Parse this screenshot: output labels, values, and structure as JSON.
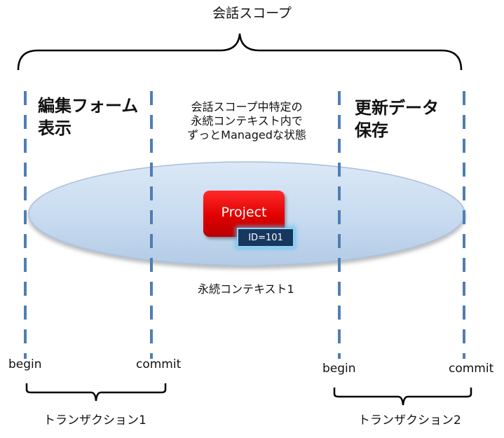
{
  "title": "会話スコープ",
  "phases": {
    "left": {
      "line1": "編集フォーム",
      "line2": "表示"
    },
    "middle": {
      "line1": "会話スコープ中特定の",
      "line2": "永続コンテキスト内で",
      "line3": "ずっとManagedな状態"
    },
    "right": {
      "line1": "更新データ",
      "line2": "保存"
    }
  },
  "persistence_context": {
    "entity_label": "Project",
    "id_label": "ID=101",
    "caption": "永続コンテキスト1"
  },
  "transactions": [
    {
      "begin": "begin",
      "commit": "commit",
      "label": "トランザクション1"
    },
    {
      "begin": "begin",
      "commit": "commit",
      "label": "トランザクション2"
    }
  ],
  "colors": {
    "dashed_line": "#4f7eb3",
    "ellipse_fill": "#c5d9ef",
    "ellipse_stroke": "#a9bfdb",
    "project_fill": "#e00000",
    "id_badge_fill": "#17375e",
    "id_badge_glow": "#8fd3f5",
    "bracket": "#000000"
  }
}
